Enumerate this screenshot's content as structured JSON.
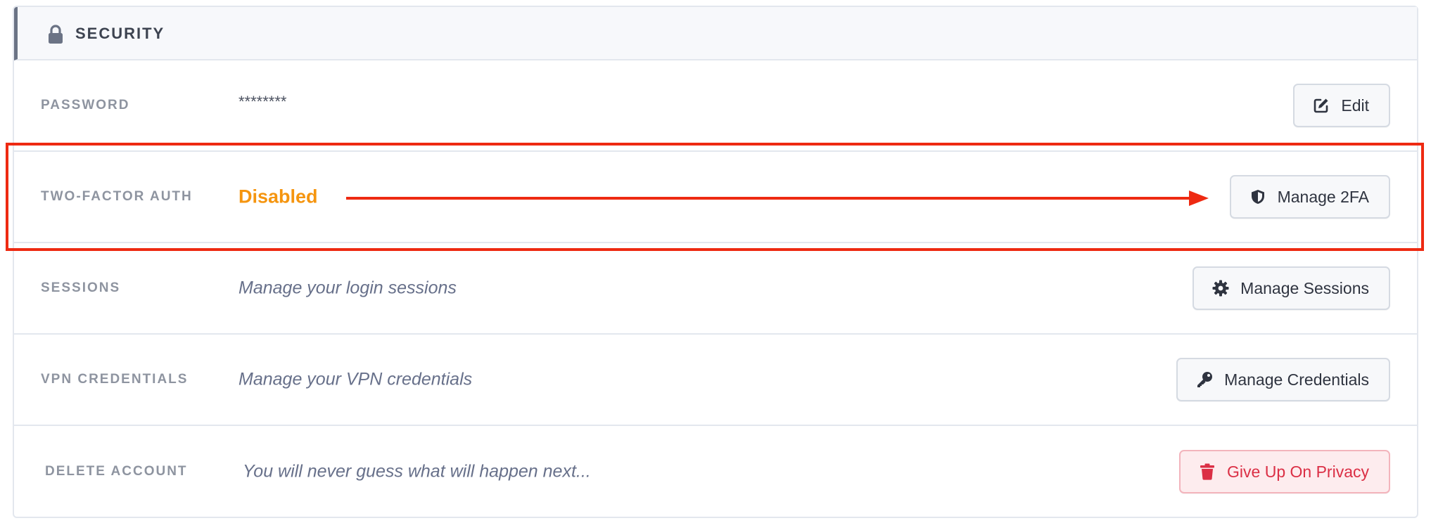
{
  "section": {
    "title": "SECURITY",
    "icon": "lock-icon"
  },
  "rows": [
    {
      "label": "PASSWORD",
      "value": "********",
      "button": {
        "label": "Edit",
        "icon": "edit-icon"
      }
    },
    {
      "label": "TWO-FACTOR AUTH",
      "value": "Disabled",
      "button": {
        "label": "Manage 2FA",
        "icon": "shield-icon"
      }
    },
    {
      "label": "SESSIONS",
      "value": "Manage your login sessions",
      "button": {
        "label": "Manage Sessions",
        "icon": "gear-icon"
      }
    },
    {
      "label": "VPN CREDENTIALS",
      "value": "Manage your VPN credentials",
      "button": {
        "label": "Manage Credentials",
        "icon": "key-icon"
      }
    },
    {
      "label": "DELETE ACCOUNT",
      "value": "You will never guess what will happen next...",
      "button": {
        "label": "Give Up On Privacy",
        "icon": "trash-icon"
      }
    }
  ],
  "colors": {
    "status_disabled": "#f5950f",
    "danger": "#db2f45",
    "annotation": "#ee2a12"
  }
}
